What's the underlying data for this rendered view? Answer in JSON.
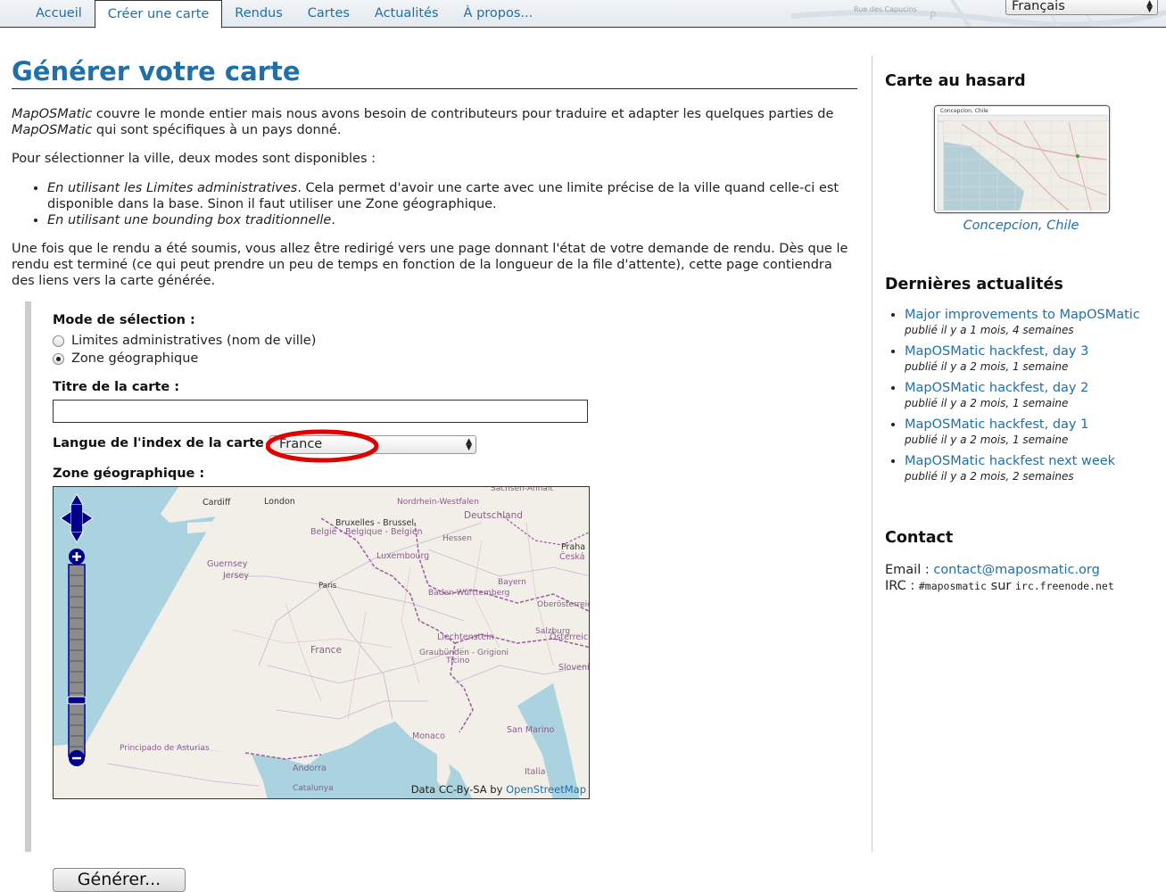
{
  "nav": {
    "tabs": [
      {
        "label": "Accueil",
        "active": false
      },
      {
        "label": "Créer une carte",
        "active": true
      },
      {
        "label": "Rendus",
        "active": false
      },
      {
        "label": "Cartes",
        "active": false
      },
      {
        "label": "Actualités",
        "active": false
      },
      {
        "label": "À propos...",
        "active": false
      }
    ],
    "street_label": "Rue des Capucins",
    "language_select": "Français"
  },
  "main": {
    "title": "Générer votre carte",
    "intro_brand": "MapOSMatic",
    "intro_text_1": " couvre le monde entier mais nous avons besoin de contributeurs pour traduire et adapter les quelques parties de ",
    "intro_brand_2": "MapOSMatic",
    "intro_text_2": " qui sont spécifiques à un pays donné.",
    "modes_intro": "Pour sélectionner la ville, deux modes sont disponibles :",
    "mode_1_em": "En utilisant les Limites administratives",
    "mode_1_rest": ". Cela permet d'avoir une carte avec une limite précise de la ville quand celle-ci est disponible dans la base. Sinon il faut utiliser une Zone géographique.",
    "mode_2_em": "En utilisant une bounding box traditionnelle",
    "mode_2_rest": ".",
    "after_submit": "Une fois que le rendu a été soumis, vous allez être redirigé vers une page donnant l'état de votre demande de rendu. Dès que le rendu est terminé (ce qui peut prendre un peu de temps en fonction de la longueur de la file d'attente), cette page contiendra des liens vers la carte générée."
  },
  "form": {
    "selection_mode_label": "Mode de sélection :",
    "option_admin": "Limites administratives (nom de ville)",
    "option_bbox": "Zone géographique",
    "selected_option": "Zone géographique",
    "map_title_label": "Titre de la carte :",
    "map_title_value": "",
    "index_language_label": "Langue de l'index de la carte",
    "index_language_value": "France",
    "geo_zone_label": "Zone géographique :",
    "generate_button": "Générer..."
  },
  "map": {
    "labels": {
      "cardiff": "Cardiff",
      "london": "London",
      "bruxelles": "Bruxelles - Brussel",
      "belgique": "België - Belgique - Belgien",
      "deutschland": "Deutschland",
      "nordrhein": "Nordrhein-Westfalen",
      "sachsen": "Sachsen-Anhalt",
      "hessen": "Hessen",
      "praha": "Praha",
      "ceska": "Česká",
      "luxembourg": "Luxembourg",
      "guernsey": "Guernsey",
      "jersey": "Jersey",
      "paris": "Paris",
      "baden": "Baden-Württemberg",
      "bayern": "Bayern",
      "oberosterreich": "Oberösterreich",
      "salzburg": "Salzburg",
      "osterreich": "Österreich",
      "liechtenstein": "Liechtenstein",
      "graubunden": "Graubünden - Grigioni",
      "ticino": "Ticino",
      "france": "France",
      "slovenija": "Slovenija",
      "monaco": "Monaco",
      "sanmarino": "San Marino",
      "asturias": "Principado de Asturias",
      "andorra": "Andorra",
      "catalunya": "Catalunya",
      "italia": "Italia"
    },
    "attribution_prefix": "Data CC-By-SA by ",
    "attribution_link": "OpenStreetMap"
  },
  "sidebar": {
    "random_map_heading": "Carte au hasard",
    "random_map_thumb_title": "Concepcion, Chile",
    "random_map_caption": "Concepcion, Chile",
    "news_heading": "Dernières actualités",
    "news": [
      {
        "title": "Major improvements to MapOSMatic",
        "date": "publié il y a 1 mois, 4 semaines"
      },
      {
        "title": "MapOSMatic hackfest, day 3",
        "date": "publié il y a 2 mois, 1 semaine"
      },
      {
        "title": "MapOSMatic hackfest, day 2",
        "date": "publié il y a 2 mois, 1 semaine"
      },
      {
        "title": "MapOSMatic hackfest, day 1",
        "date": "publié il y a 2 mois, 1 semaine"
      },
      {
        "title": "MapOSMatic hackfest next week",
        "date": "publié il y a 2 mois, 2 semaines"
      }
    ],
    "contact_heading": "Contact",
    "email_label": "Email : ",
    "email": "contact@maposmatic.org",
    "irc_label": "IRC : ",
    "irc_channel": "#maposmatic",
    "irc_sep": " sur ",
    "irc_server": "irc.freenode.net"
  },
  "colors": {
    "link": "#1f6fa8",
    "annotation": "#e00000",
    "sea": "#aad3df",
    "land": "#f2efe9",
    "border": "#9e5b9e"
  },
  "icons": {
    "pan": "pan-arrows-icon",
    "zoom_in": "zoom-in-icon",
    "zoom_out": "zoom-out-icon"
  }
}
